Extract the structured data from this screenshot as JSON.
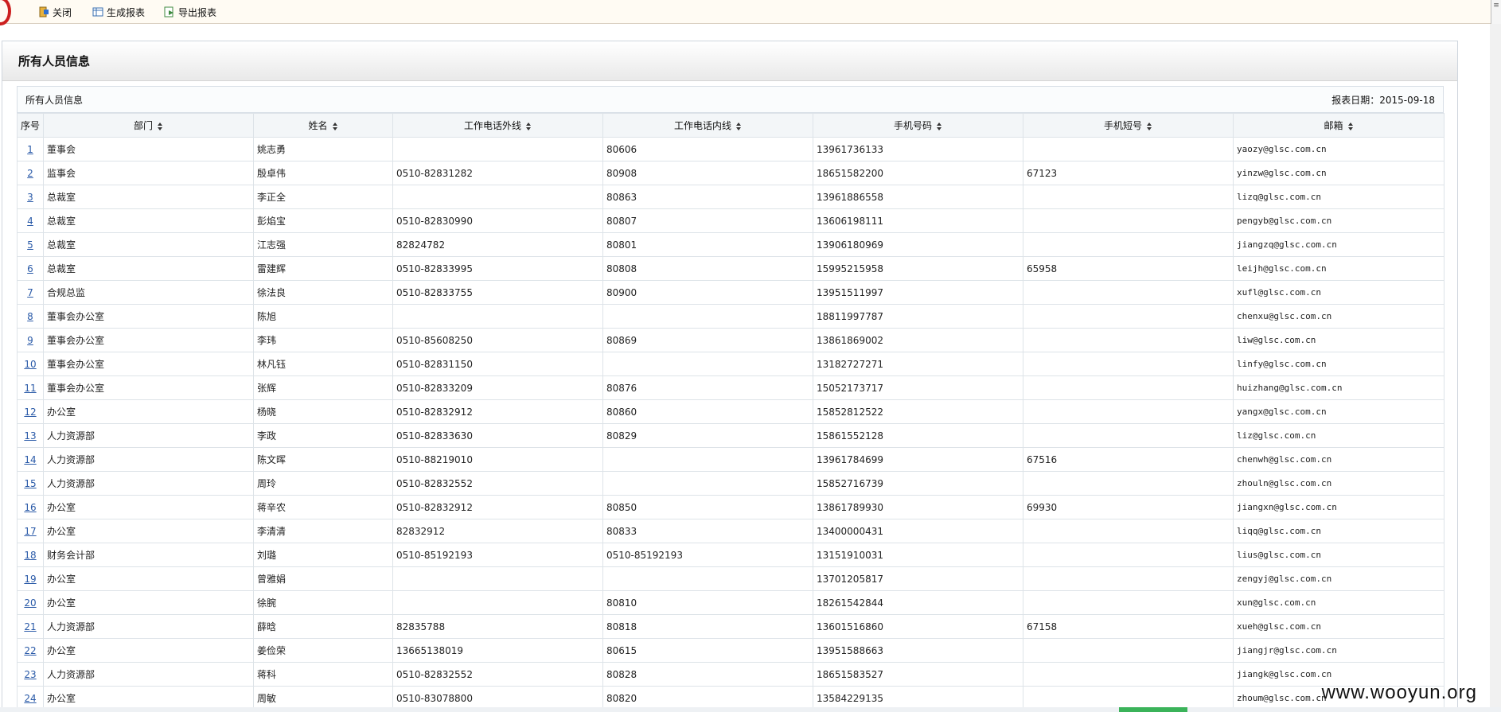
{
  "toolbar": {
    "close_label": "关闭",
    "generate_label": "生成报表",
    "export_label": "导出报表"
  },
  "panel": {
    "title": "所有人员信息"
  },
  "report": {
    "name": "所有人员信息",
    "date_label": "报表日期：2015-09-18"
  },
  "table": {
    "columns": [
      "序号",
      "部门",
      "姓名",
      "工作电话外线",
      "工作电话内线",
      "手机号码",
      "手机短号",
      "邮箱"
    ],
    "rows": [
      [
        "1",
        "董事会",
        "姚志勇",
        "",
        "80606",
        "13961736133",
        "",
        "yaozy@glsc.com.cn"
      ],
      [
        "2",
        "监事会",
        "殷卓伟",
        "0510-82831282",
        "80908",
        "18651582200",
        "67123",
        "yinzw@glsc.com.cn"
      ],
      [
        "3",
        "总裁室",
        "李正全",
        "",
        "80863",
        "13961886558",
        "",
        "lizq@glsc.com.cn"
      ],
      [
        "4",
        "总裁室",
        "彭焰宝",
        "0510-82830990",
        "80807",
        "13606198111",
        "",
        "pengyb@glsc.com.cn"
      ],
      [
        "5",
        "总裁室",
        "江志强",
        "82824782",
        "80801",
        "13906180969",
        "",
        "jiangzq@glsc.com.cn"
      ],
      [
        "6",
        "总裁室",
        "雷建辉",
        "0510-82833995",
        "80808",
        "15995215958",
        "65958",
        "leijh@glsc.com.cn"
      ],
      [
        "7",
        "合规总监",
        "徐法良",
        "0510-82833755",
        "80900",
        "13951511997",
        "",
        "xufl@glsc.com.cn"
      ],
      [
        "8",
        "董事会办公室",
        "陈旭",
        "",
        "",
        "18811997787",
        "",
        "chenxu@glsc.com.cn"
      ],
      [
        "9",
        "董事会办公室",
        "李玮",
        "0510-85608250",
        "80869",
        "13861869002",
        "",
        "liw@glsc.com.cn"
      ],
      [
        "10",
        "董事会办公室",
        "林凡钰",
        "0510-82831150",
        "",
        "13182727271",
        "",
        "linfy@glsc.com.cn"
      ],
      [
        "11",
        "董事会办公室",
        "张辉",
        "0510-82833209",
        "80876",
        "15052173717",
        "",
        "huizhang@glsc.com.cn"
      ],
      [
        "12",
        "办公室",
        "杨晓",
        "0510-82832912",
        "80860",
        "15852812522",
        "",
        "yangx@glsc.com.cn"
      ],
      [
        "13",
        "人力资源部",
        "李政",
        "0510-82833630",
        "80829",
        "15861552128",
        "",
        "liz@glsc.com.cn"
      ],
      [
        "14",
        "人力资源部",
        "陈文晖",
        "0510-88219010",
        "",
        "13961784699",
        "67516",
        "chenwh@glsc.com.cn"
      ],
      [
        "15",
        "人力资源部",
        "周玲",
        "0510-82832552",
        "",
        "15852716739",
        "",
        "zhouln@glsc.com.cn"
      ],
      [
        "16",
        "办公室",
        "蒋辛农",
        "0510-82832912",
        "80850",
        "13861789930",
        "69930",
        "jiangxn@glsc.com.cn"
      ],
      [
        "17",
        "办公室",
        "李清清",
        "82832912",
        "80833",
        "13400000431",
        "",
        "liqq@glsc.com.cn"
      ],
      [
        "18",
        "财务会计部",
        "刘璐",
        "0510-85192193",
        "0510-85192193",
        "13151910031",
        "",
        "lius@glsc.com.cn"
      ],
      [
        "19",
        "办公室",
        "曾雅娟",
        "",
        "",
        "13701205817",
        "",
        "zengyj@glsc.com.cn"
      ],
      [
        "20",
        "办公室",
        "徐腕",
        "",
        "80810",
        "18261542844",
        "",
        "xun@glsc.com.cn"
      ],
      [
        "21",
        "人力资源部",
        "薛晗",
        "82835788",
        "80818",
        "13601516860",
        "67158",
        "xueh@glsc.com.cn"
      ],
      [
        "22",
        "办公室",
        "姜俭荣",
        "13665138019",
        "80615",
        "13951588663",
        "",
        "jiangjr@glsc.com.cn"
      ],
      [
        "23",
        "人力资源部",
        "蒋科",
        "0510-82832552",
        "80828",
        "18651583527",
        "",
        "jiangk@glsc.com.cn"
      ],
      [
        "24",
        "办公室",
        "周敏",
        "0510-83078800",
        "80820",
        "13584229135",
        "",
        "zhoum@glsc.com.cn"
      ]
    ]
  },
  "watermark": "www.wooyun.org",
  "colors": {
    "link": "#2a5aa8",
    "border": "#dde3e8",
    "toolbar_bg": "#fffbf3",
    "logo": "#cc1f1f"
  }
}
